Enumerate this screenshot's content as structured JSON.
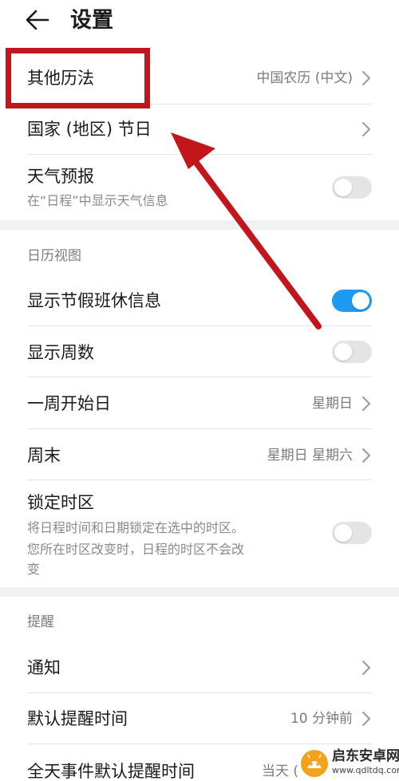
{
  "header": {
    "title": "设置",
    "back_icon": "back-arrow-icon"
  },
  "settings": {
    "other_calendar": {
      "label": "其他历法",
      "value": "中国农历 (中文)"
    },
    "holidays": {
      "label": "国家 (地区) 节日"
    },
    "weather": {
      "label": "天气预报",
      "description": "在“日程”中显示天气信息",
      "enabled": false
    }
  },
  "calendar_view": {
    "section_label": "日历视图",
    "show_holiday_info": {
      "label": "显示节假班休信息",
      "enabled": true
    },
    "show_week_numbers": {
      "label": "显示周数",
      "enabled": false
    },
    "week_start": {
      "label": "一周开始日",
      "value": "星期日"
    },
    "weekend": {
      "label": "周末",
      "value": "星期日 星期六"
    },
    "lock_timezone": {
      "label": "锁定时区",
      "description_lines": [
        "将日程时间和日期锁定在选中的时区。",
        "您所在时区改变时，日程的时区不会改",
        "变"
      ],
      "enabled": false
    }
  },
  "reminders": {
    "section_label": "提醒",
    "notifications": {
      "label": "通知"
    },
    "default_reminder_time": {
      "label": "默认提醒时间",
      "value": "10 分钟前"
    },
    "allday_reminder_time": {
      "label": "全天事件默认提醒时间",
      "value": "当天 ("
    }
  },
  "watermark": {
    "name": "启东安卓网",
    "url": "www.qdltdq.com"
  },
  "colors": {
    "annotation_red": "#c0161c",
    "toggle_on": "#1e9bf0",
    "toggle_off": "#e4e4e4",
    "section_gap": "#f1f1f1"
  }
}
